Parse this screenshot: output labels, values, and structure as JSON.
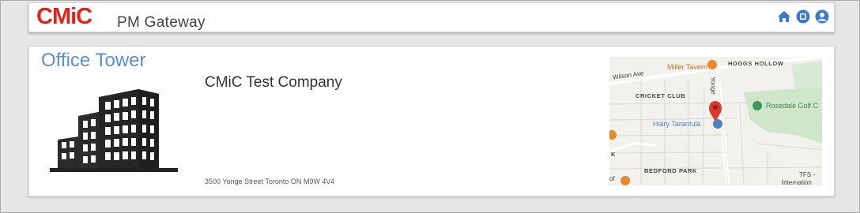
{
  "header": {
    "logo_text": "CMiC",
    "app_title": "PM Gateway",
    "icons": [
      "home-icon",
      "square-icon",
      "user-icon"
    ],
    "brand_color": "#e2231a",
    "icon_color": "#3a79d0"
  },
  "project": {
    "title": "Office Tower",
    "company": "CMiC Test Company",
    "address": "3500 Yonge Street Toronto ON M9W 4V4",
    "image_icon": "building-icon"
  },
  "map": {
    "labels": {
      "hoggs_hollow": "HOGGS HOLLOW",
      "wilson_ave": "Wilson Ave",
      "miller_tavern": "Miller Tavern",
      "yonge": "Yonge",
      "cricket_club": "CRICKET CLUB",
      "rosedale": "Rosedale Golf C",
      "hairy_tarantula": "Hairy Tarantula",
      "bedford_park": "BEDFORD PARK",
      "tfs": "TFS -",
      "internation": "Internation",
      "k": "K",
      "of": "of"
    }
  }
}
